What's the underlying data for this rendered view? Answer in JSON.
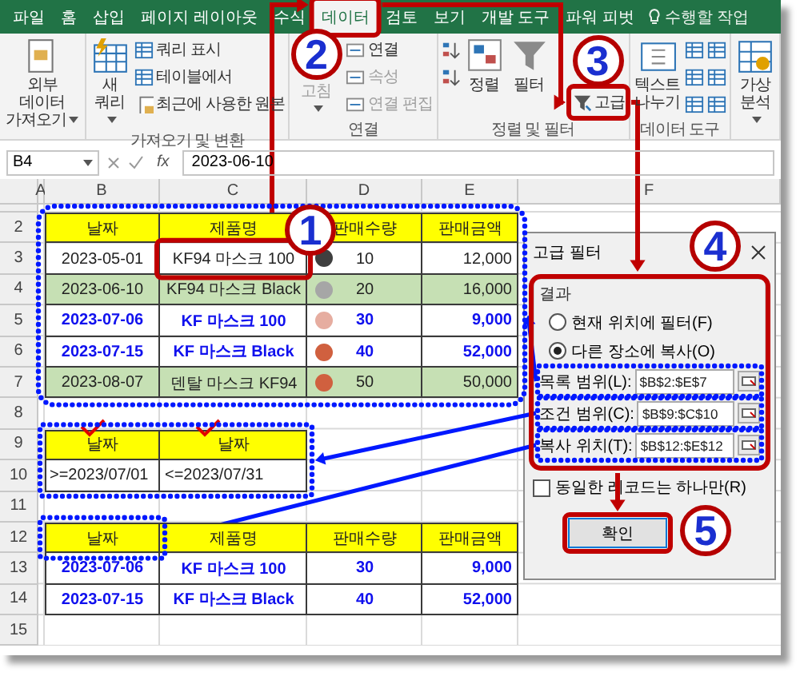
{
  "ribbon": {
    "tabs": [
      {
        "label": "파일",
        "selected": false
      },
      {
        "label": "홈",
        "selected": false
      },
      {
        "label": "삽입",
        "selected": false
      },
      {
        "label": "페이지 레이아웃",
        "selected": false
      },
      {
        "label": "수식",
        "selected": false
      },
      {
        "label": "데이터",
        "selected": true
      },
      {
        "label": "검토",
        "selected": false
      },
      {
        "label": "보기",
        "selected": false
      },
      {
        "label": "개발 도구",
        "selected": false
      },
      {
        "label": "파워 피벗",
        "selected": false
      }
    ],
    "tell_me": "수행할 작업",
    "groups": [
      {
        "buttons": [
          {
            "label": "외부 데이터 가져오기",
            "kind": "large",
            "dropdown": true
          }
        ]
      },
      {
        "label": "가져오기 및 변환",
        "buttons": [
          {
            "label": "새 쿼리",
            "kind": "large",
            "dropdown": true
          },
          {
            "label": "쿼리 표시",
            "kind": "small"
          },
          {
            "label": "테이블에서",
            "kind": "small"
          },
          {
            "label": "최근에 사용한 원본",
            "kind": "small"
          }
        ]
      },
      {
        "label": "연결",
        "buttons": [
          {
            "label": "고침",
            "kind": "large",
            "dropdown": true,
            "disabled": true
          },
          {
            "label": "연결",
            "kind": "small"
          },
          {
            "label": "속성",
            "kind": "small",
            "disabled": true
          },
          {
            "label": "연결 편집",
            "kind": "small",
            "disabled": true
          }
        ]
      },
      {
        "label": "정렬 및 필터",
        "buttons": [
          {
            "kind": "icon"
          },
          {
            "kind": "icon"
          },
          {
            "label": "정렬",
            "kind": "large"
          },
          {
            "label": "필터",
            "kind": "large"
          },
          {
            "label": "고급",
            "kind": "small"
          }
        ]
      },
      {
        "label": "데이터 도구",
        "buttons": [
          {
            "label": "텍스트 나누기",
            "kind": "large"
          },
          {
            "kind": "icon"
          },
          {
            "kind": "icon"
          },
          {
            "kind": "icon"
          },
          {
            "kind": "icon"
          },
          {
            "kind": "icon"
          },
          {
            "kind": "icon"
          }
        ]
      },
      {
        "buttons": [
          {
            "label": "가상 분석",
            "kind": "large",
            "dropdown": true
          }
        ]
      }
    ]
  },
  "formula_bar": {
    "name_box": "B4",
    "function_label": "fx",
    "value": "2023-06-10"
  },
  "sheet": {
    "columns": [
      "A",
      "B",
      "C",
      "D",
      "E",
      "F"
    ],
    "rows": [
      "2",
      "3",
      "4",
      "5",
      "6",
      "7",
      "8",
      "9",
      "10",
      "11",
      "12",
      "13",
      "14",
      "15"
    ]
  },
  "tables": [
    {
      "headers": [
        {
          "text": "날짜"
        },
        {
          "text": "제품명"
        },
        {
          "text": "판매수량"
        },
        {
          "text": "판매금액"
        }
      ],
      "rows": [
        {
          "kind": "plain",
          "color": "#3f3f3f",
          "cells": [
            "2023-05-01",
            "KF94 마스크 100",
            "10",
            "12,000"
          ]
        },
        {
          "kind": "shaded",
          "color": "#a6a6a6",
          "cells": [
            "2023-06-10",
            "KF94 마스크 Black",
            "20",
            "16,000"
          ]
        },
        {
          "kind": "match",
          "color": "#e6ada0",
          "cells": [
            "2023-07-06",
            "KF 마스크 100",
            "30",
            "9,000"
          ]
        },
        {
          "kind": "match",
          "color": "#d0603f",
          "cells": [
            "2023-07-15",
            "KF 마스크 Black",
            "40",
            "52,000"
          ]
        },
        {
          "kind": "shaded",
          "color": "#d0603f",
          "cells": [
            "2023-08-07",
            "덴탈 마스크 KF94",
            "50",
            "50,000"
          ]
        }
      ]
    },
    {
      "headers": [
        {
          "text": "날짜",
          "checked": true
        },
        {
          "text": "날짜",
          "checked": true
        }
      ],
      "rows": [
        {
          "kind": "plain",
          "cells": [
            ">=2023/07/01",
            "<=2023/07/31"
          ]
        }
      ]
    },
    {
      "headers": [
        {
          "text": "날짜"
        },
        {
          "text": "제품명"
        },
        {
          "text": "판매수량"
        },
        {
          "text": "판매금액"
        }
      ],
      "rows": [
        {
          "kind": "match",
          "cells": [
            "2023-07-06",
            "KF 마스크 100",
            "30",
            "9,000"
          ]
        },
        {
          "kind": "match",
          "cells": [
            "2023-07-15",
            "KF 마스크 Black",
            "40",
            "52,000"
          ]
        }
      ]
    }
  ],
  "dialog": {
    "title": "고급 필터",
    "group_label": "결과",
    "options": [
      {
        "label": "현재 위치에 필터(F)",
        "selected": false
      },
      {
        "label": "다른 장소에 복사(O)",
        "selected": true
      }
    ],
    "fields": [
      {
        "label": "목록 범위(L):",
        "value": "$B$2:$E$7"
      },
      {
        "label": "조건 범위(C):",
        "value": "$B$9:$C$10"
      },
      {
        "label": "복사 위치(T):",
        "value": "$B$12:$E$12"
      }
    ],
    "unique": {
      "label": "동일한 레코드는 하나만(R)",
      "checked": false
    },
    "buttons": [
      {
        "label": "확인",
        "kind": "default"
      }
    ]
  },
  "steps": [
    "1",
    "2",
    "3",
    "4",
    "5"
  ]
}
